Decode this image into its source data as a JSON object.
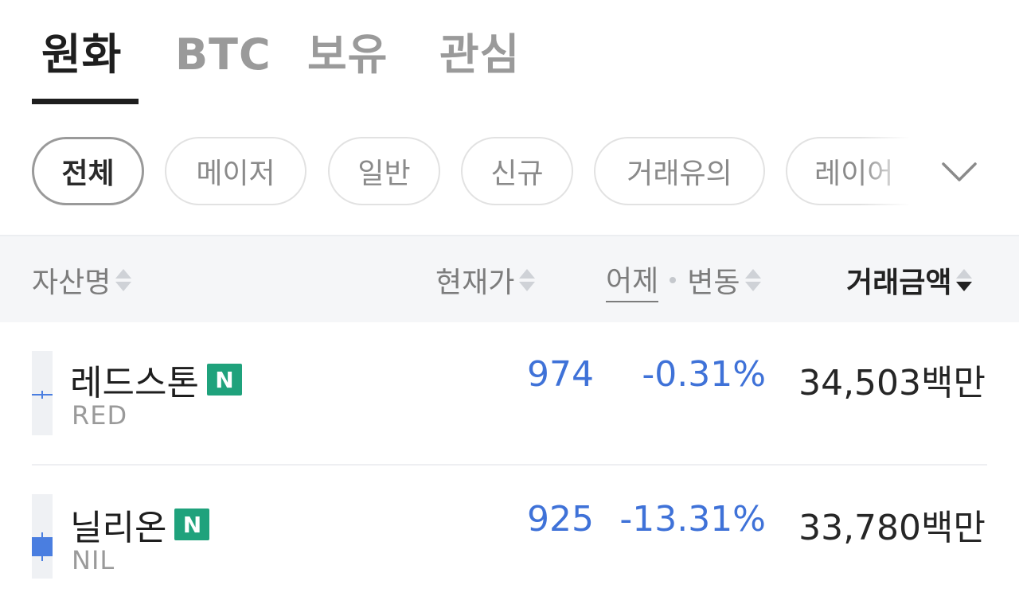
{
  "tabs": [
    {
      "label": "원화",
      "active": true
    },
    {
      "label": "BTC",
      "active": false
    },
    {
      "label": "보유",
      "active": false
    },
    {
      "label": "관심",
      "active": false
    }
  ],
  "filters": [
    {
      "label": "전체",
      "active": true
    },
    {
      "label": "메이저",
      "active": false
    },
    {
      "label": "일반",
      "active": false
    },
    {
      "label": "신규",
      "active": false
    },
    {
      "label": "거래유의",
      "active": false
    },
    {
      "label": "레이어",
      "active": false
    }
  ],
  "filters_more_icon": "chevron-down-icon",
  "table_header": {
    "asset_name": "자산명",
    "current_price": "현재가",
    "yesterday": "어제",
    "change": "변동",
    "trade_amount": "거래금액",
    "sorted_by": "거래금액",
    "sort_direction": "desc"
  },
  "rows": [
    {
      "name": "레드스톤",
      "badge": "N",
      "ticker": "RED",
      "price": "974",
      "change": "-0.31%",
      "trade_amount": "34,503백만"
    },
    {
      "name": "닐리온",
      "badge": "N",
      "ticker": "NIL",
      "price": "925",
      "change": "-13.31%",
      "trade_amount": "33,780백만"
    }
  ],
  "colors": {
    "down": "#3f72d8",
    "badge_new": "#1fa27c",
    "text_primary": "#1e1e1e",
    "text_muted": "#9a9a9a",
    "header_bg": "#f5f6f8"
  }
}
